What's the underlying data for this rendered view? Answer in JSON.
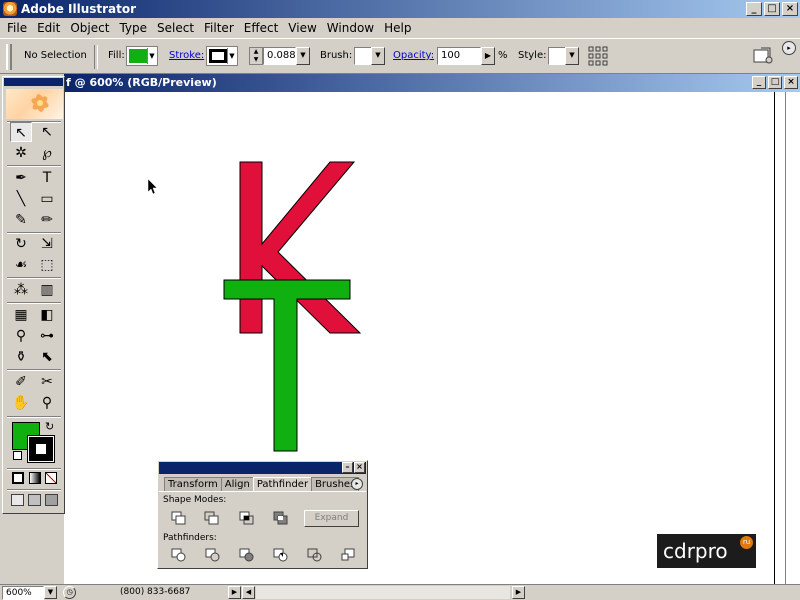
{
  "app": {
    "title": "Adobe Illustrator"
  },
  "window_buttons": {
    "minimize": "_",
    "restore": "□",
    "close": "×"
  },
  "menu": [
    "File",
    "Edit",
    "Object",
    "Type",
    "Select",
    "Filter",
    "Effect",
    "View",
    "Window",
    "Help"
  ],
  "control": {
    "selection": "No Selection",
    "fill_label": "Fill:",
    "stroke_label": "Stroke:",
    "stroke_weight": "0.088",
    "brush_label": "Brush:",
    "opacity_label": "Opacity:",
    "opacity_value": "100",
    "percent": "%",
    "style_label": "Style:",
    "fill_color": "#10b010",
    "stroke_color": "#000000"
  },
  "document": {
    "title": "f @ 600% (RGB/Preview)"
  },
  "toolbox": {
    "tools": [
      {
        "name": "selection-tool-icon",
        "glyph": "↖"
      },
      {
        "name": "direct-selection-tool-icon",
        "glyph": "↖"
      },
      {
        "name": "magic-wand-tool-icon",
        "glyph": "✲"
      },
      {
        "name": "lasso-tool-icon",
        "glyph": "℘"
      },
      {
        "name": "pen-tool-icon",
        "glyph": "✒"
      },
      {
        "name": "type-tool-icon",
        "glyph": "T"
      },
      {
        "name": "line-tool-icon",
        "glyph": "╲"
      },
      {
        "name": "rectangle-tool-icon",
        "glyph": "▭"
      },
      {
        "name": "paintbrush-tool-icon",
        "glyph": "✎"
      },
      {
        "name": "pencil-tool-icon",
        "glyph": "✏"
      },
      {
        "name": "rotate-tool-icon",
        "glyph": "↻"
      },
      {
        "name": "scale-tool-icon",
        "glyph": "⇲"
      },
      {
        "name": "warp-tool-icon",
        "glyph": "☙"
      },
      {
        "name": "free-transform-tool-icon",
        "glyph": "⬚"
      },
      {
        "name": "symbol-sprayer-tool-icon",
        "glyph": "⁂"
      },
      {
        "name": "graph-tool-icon",
        "glyph": "▥"
      },
      {
        "name": "mesh-tool-icon",
        "glyph": "▦"
      },
      {
        "name": "gradient-tool-icon",
        "glyph": "◧"
      },
      {
        "name": "eyedropper-tool-icon",
        "glyph": "⚲"
      },
      {
        "name": "blend-tool-icon",
        "glyph": "⊶"
      },
      {
        "name": "live-paint-bucket-tool-icon",
        "glyph": "⚱"
      },
      {
        "name": "live-paint-selection-tool-icon",
        "glyph": "⬉"
      },
      {
        "name": "slice-tool-icon",
        "glyph": "✐"
      },
      {
        "name": "scissors-tool-icon",
        "glyph": "✂"
      },
      {
        "name": "hand-tool-icon",
        "glyph": "✋"
      },
      {
        "name": "zoom-tool-icon",
        "glyph": "⚲"
      }
    ],
    "fill_color": "#10b010",
    "stroke_color": "#000000"
  },
  "artwork": {
    "k_color": "#e0103a",
    "t_color": "#10b010"
  },
  "pathfinder": {
    "tabs": [
      "Transform",
      "Align",
      "Pathfinder",
      "Brushes"
    ],
    "active_tab": "Pathfinder",
    "shape_modes_label": "Shape Modes:",
    "expand_label": "Expand",
    "pathfinders_label": "Pathfinders:",
    "menu_glyph": "▸"
  },
  "status": {
    "zoom": "600%",
    "phone": "(800) 833-6687"
  },
  "watermark": {
    "brand": "cdrpro",
    "badge": "ru"
  }
}
